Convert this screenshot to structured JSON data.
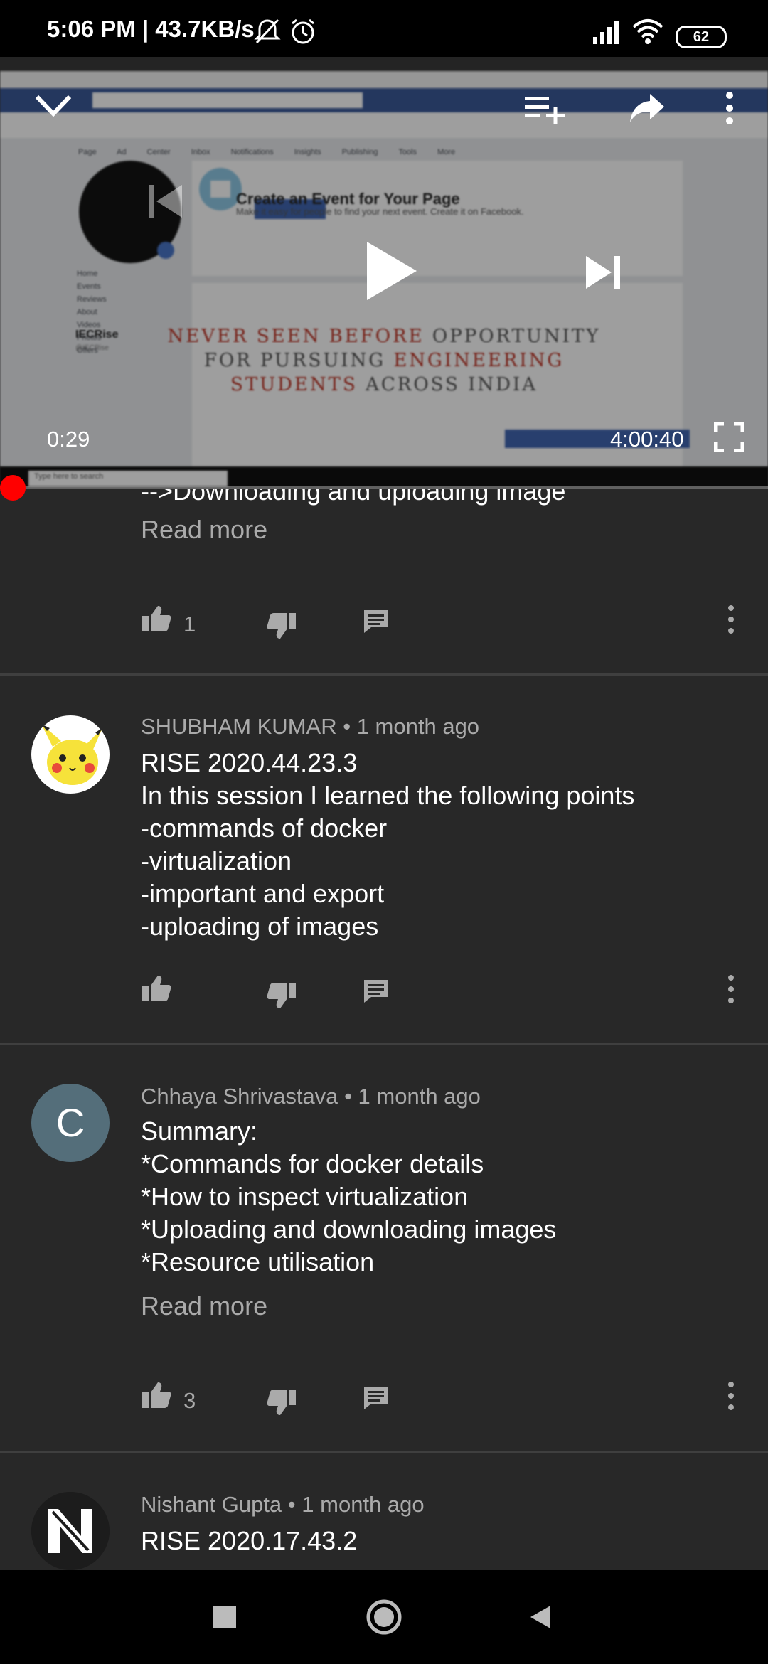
{
  "status_bar": {
    "time": "5:06 PM",
    "separator": "|",
    "speed": "43.7KB/s",
    "battery": "62",
    "icons": [
      "mute-bell-icon",
      "alarm-icon",
      "signal-icon",
      "wifi-icon",
      "battery-icon"
    ]
  },
  "player": {
    "current_time": "0:29",
    "duration": "4:00:40",
    "progress_fraction": 0.002,
    "controls": [
      "collapse-chevron-icon",
      "add-to-queue-icon",
      "share-icon",
      "more-vert-icon",
      "previous-icon",
      "play-icon",
      "next-icon",
      "fullscreen-icon"
    ],
    "video_text": {
      "line1a": "NEVER SEEN BEFORE ",
      "line1b": "OPPORTUNITY",
      "line2a": "FOR PURSUING ",
      "line2b": "ENGINEERING",
      "line3a": "STUDENTS ",
      "line3b": "ACROSS INDIA",
      "event_title": "Create an Event for Your Page",
      "event_sub": "Make it easy for people to find your next event. Create it on Facebook.",
      "event_button": "Create Event",
      "page_name": "IECRise",
      "page_handle": "@IECRise",
      "tabs": [
        "Page",
        "Ad Center",
        "Inbox",
        "Notifications",
        "Insights",
        "Publishing Tools",
        "More"
      ],
      "left_nav": [
        "Home",
        "Events",
        "Reviews",
        "About",
        "Videos",
        "Photos",
        "Offers"
      ],
      "search_placeholder": "Type here to search"
    },
    "accent": "#ff0000"
  },
  "comments": [
    {
      "partial_line": "-->Downloading and uploading image",
      "read_more": "Read more",
      "likes": "1"
    },
    {
      "author": "SHUBHAM KUMAR",
      "time": "1 month ago",
      "text": "RISE 2020.44.23.3\nIn this session I learned the following points\n-commands of docker\n-virtualization\n-important and export\n-uploading of images",
      "likes": ""
    },
    {
      "author": "Chhaya Shrivastava",
      "time": "1 month ago",
      "avatar_letter": "C",
      "text": "Summary:\n*Commands for docker details\n*How to inspect virtualization\n*Uploading and downloading images\n*Resource utilisation",
      "read_more": "Read more",
      "likes": "3"
    },
    {
      "author": "Nishant Gupta",
      "time": "1 month ago",
      "text": "RISE 2020.17.43.2"
    }
  ],
  "meta_separator": "•",
  "nav_bar": [
    "recents-square-icon",
    "home-circle-icon",
    "back-triangle-icon"
  ]
}
